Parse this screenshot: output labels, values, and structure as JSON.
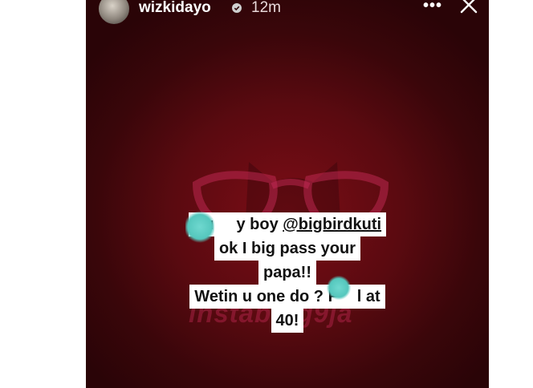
{
  "header": {
    "username": "wizkidayo",
    "time_ago": "12m",
    "more_label": "•••",
    "close_label": "×"
  },
  "caption": {
    "line1_pre": "Pu",
    "line1_mid": "y boy ",
    "line1_mention": "@bigbirdkuti",
    "line2": "ok I big pass your",
    "line3": "papa!!",
    "line4_pre": "Wetin u one do ? F",
    "line4_post": "l at",
    "line5": "40!"
  },
  "watermark": {
    "text": "instablog9ja"
  },
  "colors": {
    "background": "#5a0a10",
    "caption_bg": "#ffffff",
    "caption_text": "#111111",
    "watermark": "#c32a55",
    "censor_blot": "#55c7bd"
  }
}
